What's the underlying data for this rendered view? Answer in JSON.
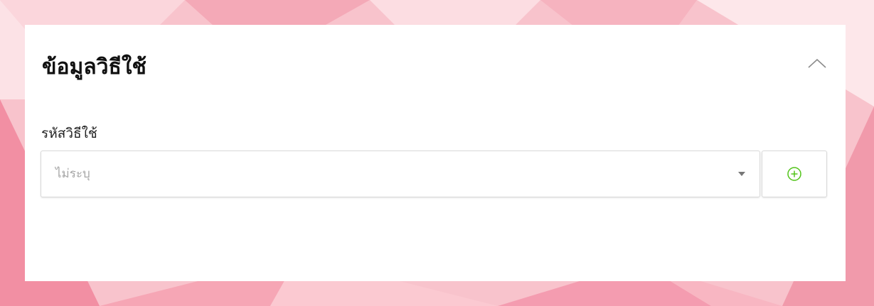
{
  "panel": {
    "title": "ข้อมูลวิธีใช้",
    "collapse_icon": "chevron-up-icon"
  },
  "field": {
    "label": "รหัสวิธีใช้",
    "placeholder": "ไม่ระบุ",
    "dropdown_icon": "caret-down-icon",
    "add_icon": "plus-circle-icon"
  },
  "colors": {
    "accent_green": "#52c41a",
    "background_pink": "#f6b9c4",
    "card_white": "#ffffff"
  }
}
